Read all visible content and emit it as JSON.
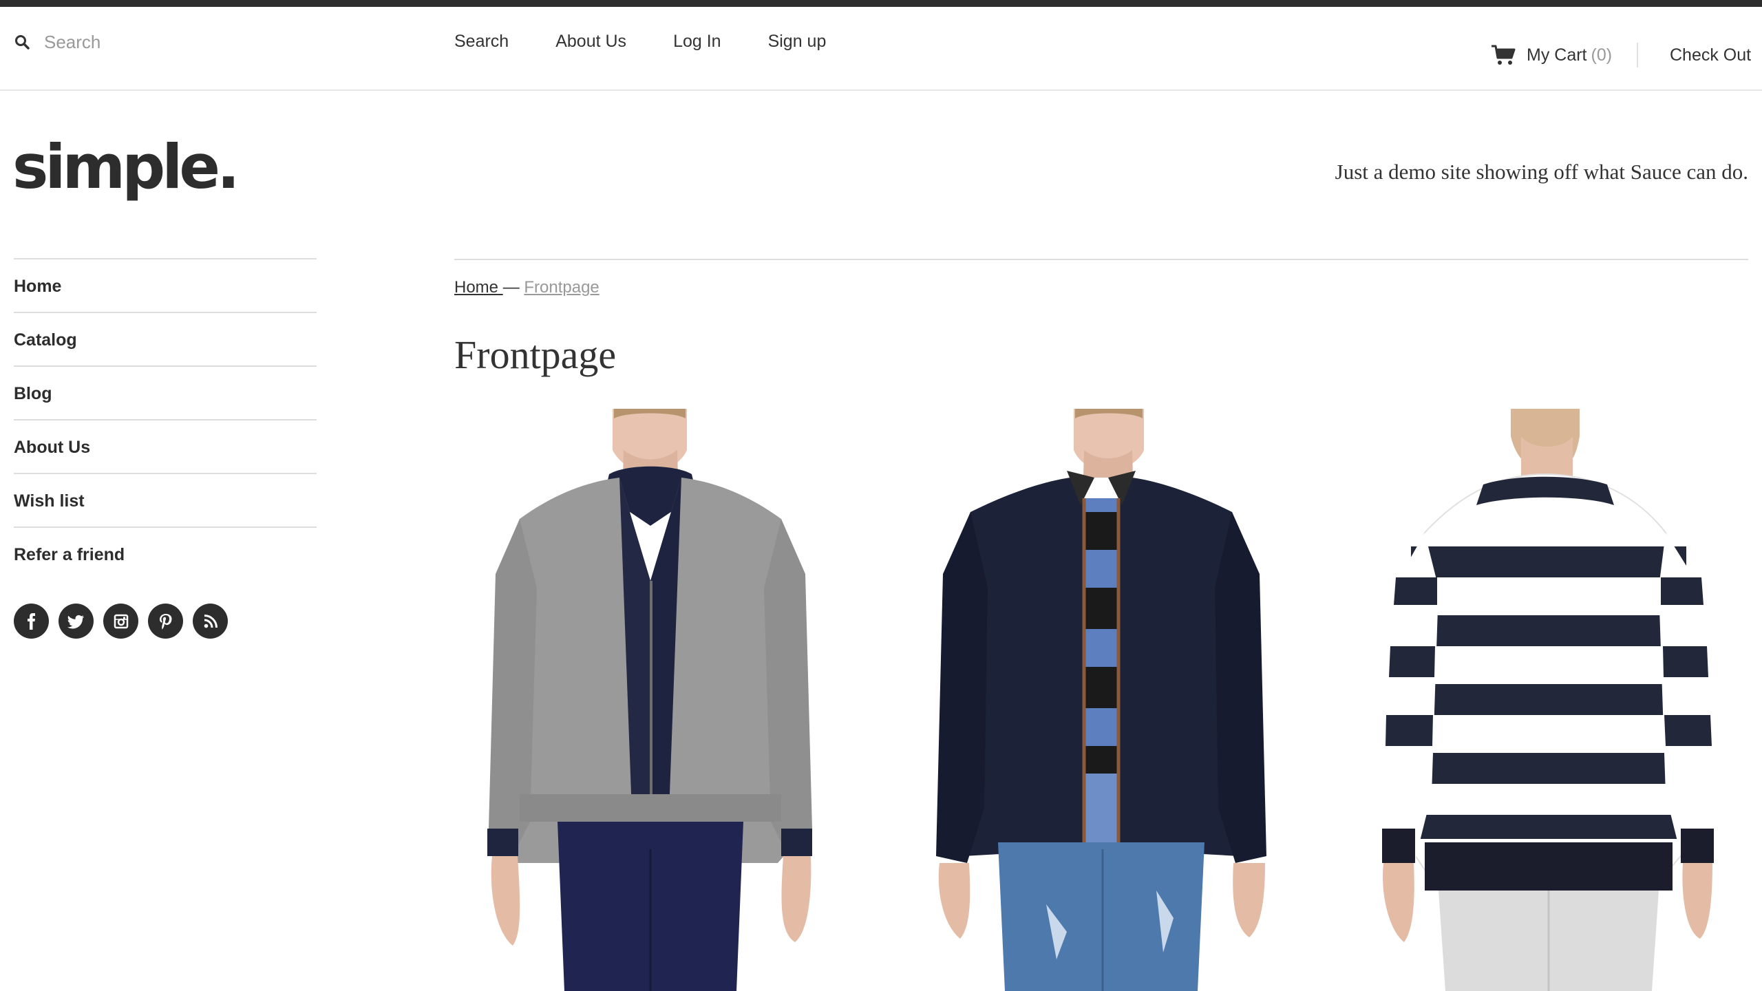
{
  "header": {
    "search_placeholder": "Search",
    "nav": [
      "Search",
      "About Us",
      "Log In",
      "Sign up"
    ],
    "cart_label": "My Cart",
    "cart_count": "(0)",
    "checkout_label": "Check Out"
  },
  "brand": {
    "logo_text": "simple.",
    "tagline": "Just a demo site showing off what Sauce can do."
  },
  "sidebar": {
    "items": [
      "Home",
      "Catalog",
      "Blog",
      "About Us",
      "Wish list",
      "Refer a friend"
    ],
    "socials": [
      "facebook-icon",
      "twitter-icon",
      "instagram-icon",
      "pinterest-icon",
      "rss-icon"
    ]
  },
  "main": {
    "breadcrumb_home": "Home ",
    "breadcrumb_separator": "—",
    "breadcrumb_current": "Frontpage",
    "title": "Frontpage"
  },
  "colors": {
    "text": "#333333",
    "muted": "#999999",
    "topbar": "#2d2d2d",
    "border": "#dddddd"
  }
}
